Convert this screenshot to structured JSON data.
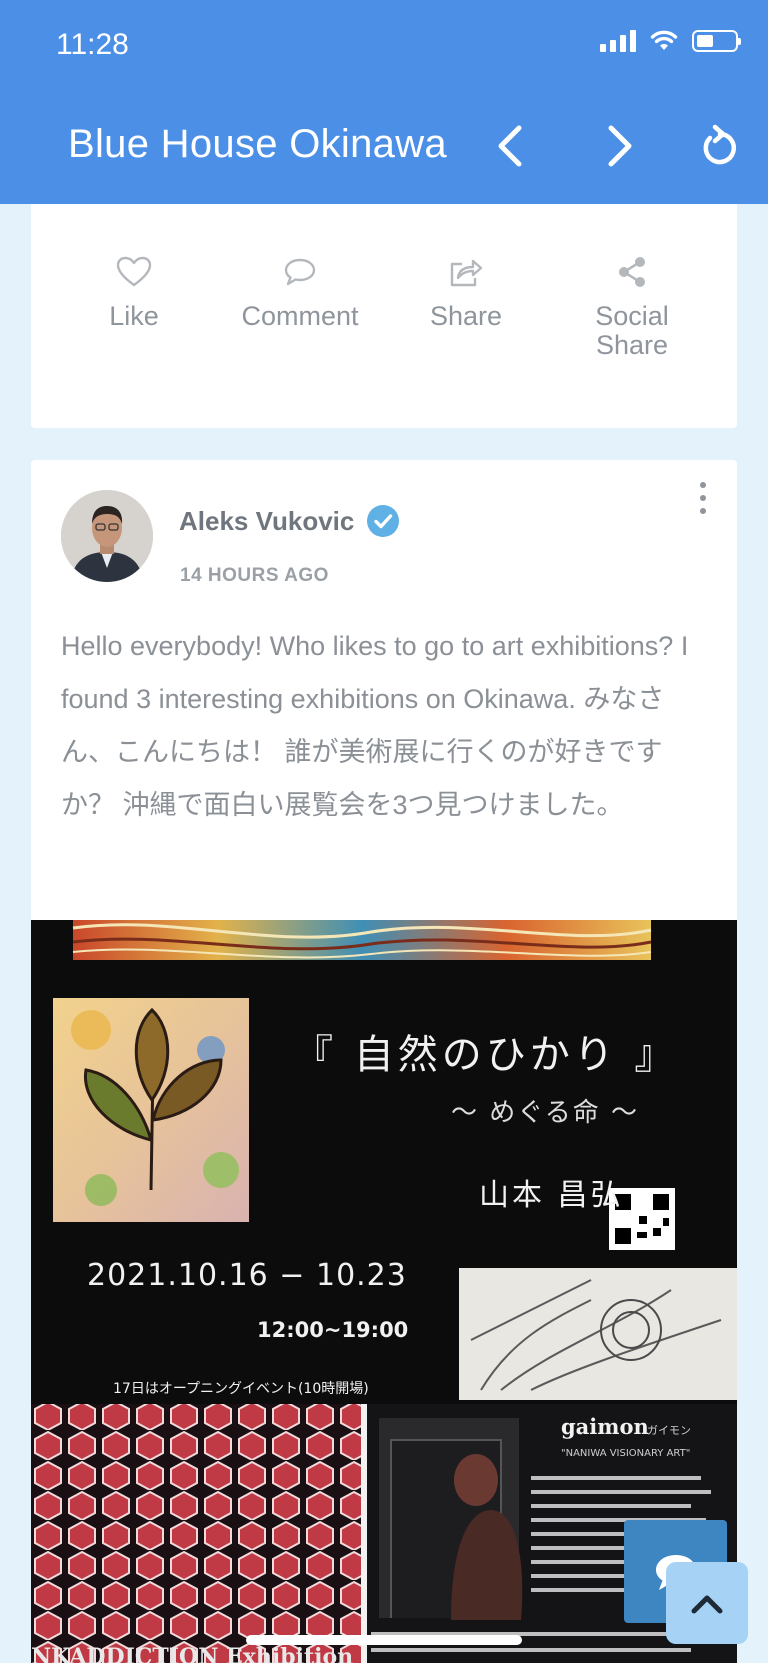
{
  "status_bar": {
    "time": "11:28"
  },
  "nav": {
    "title": "Blue House Okinawa"
  },
  "actions": [
    {
      "label": "Like",
      "icon": "heart-icon"
    },
    {
      "label": "Comment",
      "icon": "comment-icon"
    },
    {
      "label": "Share",
      "icon": "share-icon"
    },
    {
      "label_line1": "Social",
      "label_line2": "Share",
      "icon": "social-share-icon"
    }
  ],
  "post": {
    "author": "Aleks Vukovic",
    "time_ago": "14 HOURS AGO",
    "text": "Hello everybody! Who likes to go to art exhibitions? I found 3 interesting exhibitions on Okinawa. みなさん、こんにちは！ 誰が美術展に行くのが好きですか？ 沖縄で面白い展覧会を3つ見つけました。"
  },
  "poster": {
    "title": "『 自然のひかり 』",
    "subtitle": "〜 めぐる命 〜",
    "artist": "山本 昌弘",
    "dates": "2021.10.16 − 10.23",
    "hours": "12:00~19:00",
    "note": "17日はオープニングイベント(10時開場)",
    "second_artist": "gaimon",
    "second_artist_kana": "ガイモン",
    "second_tagline": "\"NANIWA VISIONARY ART\"",
    "third_title": "NKADDICTION Exhibition"
  },
  "colors": {
    "header": "#4c8fe6",
    "background": "#e3f2fb",
    "verified": "#5eb0e5",
    "chat_button": "#3e86c2",
    "top_button": "#a6d2f5"
  }
}
